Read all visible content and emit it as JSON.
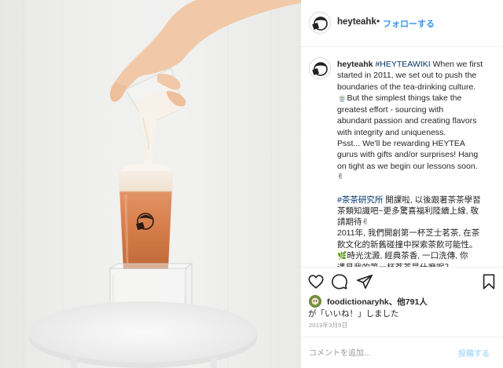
{
  "post": {
    "username": "heyteahk",
    "follow_label": "フォローする",
    "separator": "•"
  },
  "caption": {
    "username": "heyteahk",
    "hashtag": "#HEYTEAWIKI",
    "lines": [
      " When we first",
      "started in 2011, we set out to push the",
      "boundaries of the tea-drinking culture.",
      "But the simplest things take the",
      "greatest effort - sourcing with",
      "abundant passion and creating flavors",
      "with integrity and uniqueness.",
      "Psst... We'll be rewarding HEYTEA",
      "gurus with gifts and/or surprises! Hang",
      "on tight as we begin our lessons soon.",
      "✌"
    ],
    "jp_hashtag": "#茶茶研究所",
    "jp_lines": [
      " 開課啦, 以後跟著茶茶學習",
      "茶類知識吧~更多驚喜福利陸續上線, 敬",
      "請期待✌",
      "2011年, 我們開創第一杯芝士茗茶, 在茶",
      "飲文化的新舊碰撞中探索茶飲可能性。",
      "時光沈澱, 經典茶香, 一口洗傳, 你",
      "遇見我的第一杯茗茶是什麼呢？"
    ]
  },
  "actions": {
    "like": "heart-icon",
    "comment": "comment-icon",
    "share": "share-icon",
    "save": "bookmark-icon"
  },
  "likes": {
    "user": "foodictionaryhk",
    "others": "、他791人",
    "suffix": "が「いいね！」しました"
  },
  "date": "2019年3月9日",
  "comment": {
    "placeholder": "コメントを追加...",
    "post_label": "投稿する"
  },
  "colors": {
    "link": "#003569",
    "follow": "#3897f0",
    "post_disabled": "#b2dffc",
    "muted": "#999999"
  }
}
